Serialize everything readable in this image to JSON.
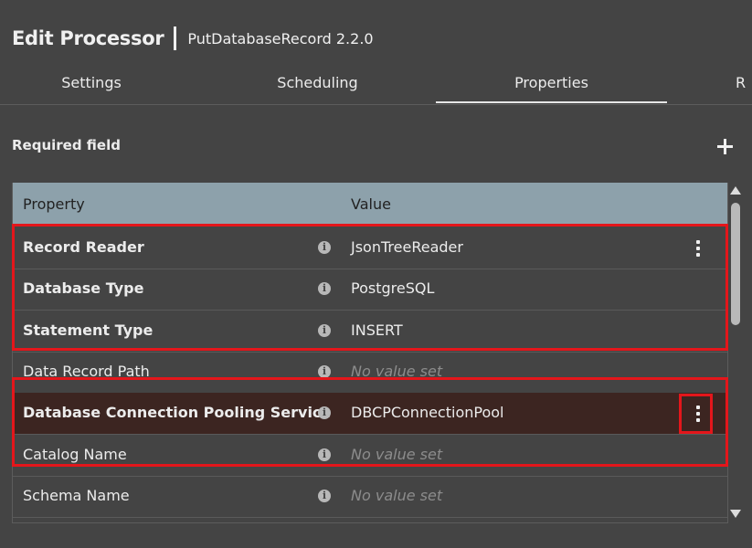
{
  "header": {
    "title": "Edit Processor",
    "subtitle": "PutDatabaseRecord 2.2.0"
  },
  "tabs": [
    {
      "label": "Settings",
      "active": false
    },
    {
      "label": "Scheduling",
      "active": false
    },
    {
      "label": "Properties",
      "active": true
    },
    {
      "label": "R",
      "active": false
    }
  ],
  "required_label": "Required field",
  "add_icon": "plus-icon",
  "table": {
    "columns": [
      "Property",
      "Value"
    ],
    "rows": [
      {
        "name": "Record Reader",
        "required": true,
        "value": "JsonTreeReader",
        "empty": false,
        "has_menu": true,
        "selected": false
      },
      {
        "name": "Database Type",
        "required": true,
        "value": "PostgreSQL",
        "empty": false,
        "has_menu": false,
        "selected": false
      },
      {
        "name": "Statement Type",
        "required": true,
        "value": "INSERT",
        "empty": false,
        "has_menu": false,
        "selected": false
      },
      {
        "name": "Data Record Path",
        "required": false,
        "value": "No value set",
        "empty": true,
        "has_menu": false,
        "selected": false
      },
      {
        "name": "Database Connection Pooling Service",
        "required": true,
        "value": "DBCPConnectionPool",
        "empty": false,
        "has_menu": true,
        "selected": true
      },
      {
        "name": "Catalog Name",
        "required": false,
        "value": "No value set",
        "empty": true,
        "has_menu": false,
        "selected": false
      },
      {
        "name": "Schema Name",
        "required": false,
        "value": "No value set",
        "empty": true,
        "has_menu": false,
        "selected": false
      }
    ]
  },
  "colors": {
    "background": "#444444",
    "header_row": "#8da1ab",
    "selected_row": "#3c2521",
    "highlight": "#e4161b"
  }
}
